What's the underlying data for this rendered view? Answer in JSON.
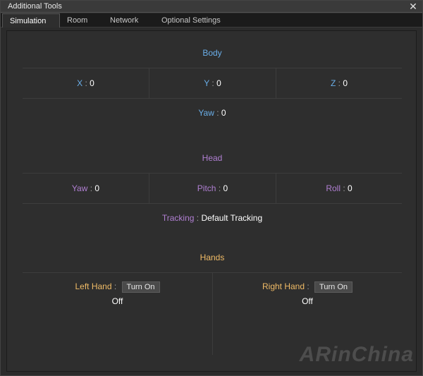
{
  "window": {
    "title": "Additional Tools",
    "close_glyph": "✕"
  },
  "tabs": [
    {
      "label": "Simulation",
      "active": true
    },
    {
      "label": "Room",
      "active": false
    },
    {
      "label": "Network",
      "active": false
    },
    {
      "label": "Optional Settings",
      "active": false
    }
  ],
  "body": {
    "title": "Body",
    "x_label": "X",
    "x_value": "0",
    "y_label": "Y",
    "y_value": "0",
    "z_label": "Z",
    "z_value": "0",
    "yaw_label": "Yaw",
    "yaw_value": "0"
  },
  "head": {
    "title": "Head",
    "yaw_label": "Yaw",
    "yaw_value": "0",
    "pitch_label": "Pitch",
    "pitch_value": "0",
    "roll_label": "Roll",
    "roll_value": "0",
    "tracking_label": "Tracking",
    "tracking_value": "Default Tracking"
  },
  "hands": {
    "title": "Hands",
    "left_label": "Left Hand",
    "left_button": "Turn On",
    "left_status": "Off",
    "right_label": "Right Hand",
    "right_button": "Turn On",
    "right_status": "Off"
  },
  "separator": " : ",
  "watermark": "ARinChina",
  "colors": {
    "body_accent": "#6aaee8",
    "head_accent": "#b07fd2",
    "hands_accent": "#f0bb66"
  }
}
